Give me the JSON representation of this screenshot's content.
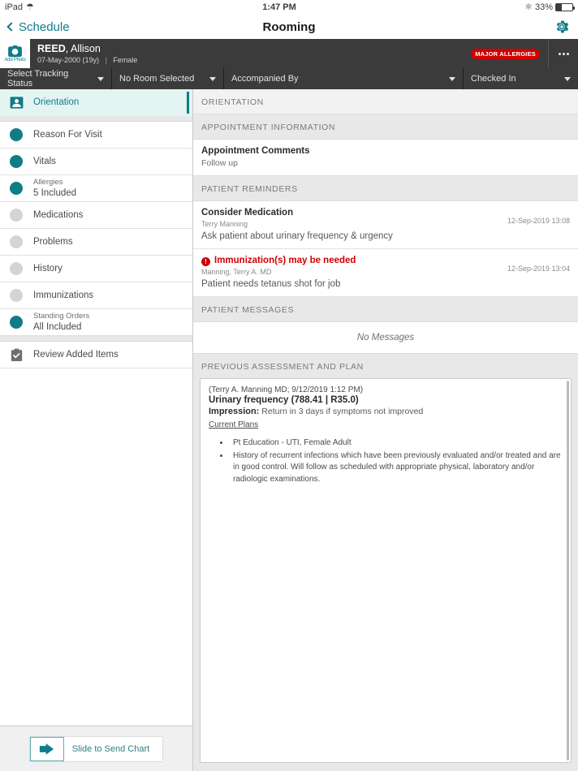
{
  "status_bar": {
    "device": "iPad",
    "wifi_icon": "wifi-icon",
    "time": "1:47 PM",
    "bluetooth_icon": "bluetooth-icon",
    "battery_percent": "33%",
    "battery_level": 33
  },
  "nav": {
    "back_label": "Schedule",
    "title": "Rooming",
    "settings_icon": "gear-icon",
    "accent_color": "#0F7C8A"
  },
  "patient": {
    "add_photo_label": "Add Photo",
    "camera_icon": "camera-icon",
    "last_name": "REED",
    "first_name": ", Allison",
    "dob": "07-May-2000 (19y)",
    "separator": "|",
    "sex": "Female",
    "allergy_badge": "MAJOR ALLERGIES",
    "allergy_color": "#d10000",
    "more_icon": "ellipsis-icon"
  },
  "dropdowns": [
    {
      "label": "Select Tracking Status",
      "name": "tracking-status-dropdown"
    },
    {
      "label": "No Room Selected",
      "name": "room-dropdown"
    },
    {
      "label": "Accompanied By",
      "name": "accompanied-by-dropdown"
    },
    {
      "label": "Checked In",
      "name": "checked-in-dropdown"
    }
  ],
  "sidebar": {
    "items": [
      {
        "label": "Orientation",
        "sub": "",
        "state": "active",
        "icon": "person-card-icon"
      },
      {
        "label": "Reason For Visit",
        "sub": "",
        "state": "filled",
        "icon": "status-dot-icon"
      },
      {
        "label": "Vitals",
        "sub": "",
        "state": "filled",
        "icon": "status-dot-icon"
      },
      {
        "label": "Allergies",
        "sub": "5 Included",
        "state": "filled",
        "icon": "status-dot-icon"
      },
      {
        "label": "Medications",
        "sub": "",
        "state": "empty",
        "icon": "status-dot-icon"
      },
      {
        "label": "Problems",
        "sub": "",
        "state": "empty",
        "icon": "status-dot-icon"
      },
      {
        "label": "History",
        "sub": "",
        "state": "empty",
        "icon": "status-dot-icon"
      },
      {
        "label": "Immunizations",
        "sub": "",
        "state": "empty",
        "icon": "status-dot-icon"
      },
      {
        "label": "Standing Orders",
        "sub": "All Included",
        "state": "filled",
        "icon": "status-dot-icon"
      }
    ],
    "review": {
      "label": "Review Added Items",
      "icon": "clipboard-check-icon"
    },
    "send": {
      "label": "Slide to Send Chart",
      "icon": "send-arrow-icon"
    }
  },
  "main": {
    "page_header": "ORIENTATION",
    "appointment_section": "APPOINTMENT INFORMATION",
    "appointment": {
      "title": "Appointment Comments",
      "body": "Follow up"
    },
    "reminders_section": "PATIENT REMINDERS",
    "reminders": [
      {
        "title": "Consider Medication",
        "author": "Terry Manning",
        "body": "Ask patient about urinary frequency & urgency",
        "time": "12-Sep-2019 13:08",
        "alert": false
      },
      {
        "title": "Immunization(s) may be needed",
        "author": "Manning, Terry A. MD",
        "body": "Patient needs tetanus shot for job",
        "time": "12-Sep-2019 13:04",
        "alert": true,
        "alert_glyph": "!"
      }
    ],
    "messages_section": "PATIENT MESSAGES",
    "no_messages": "No Messages",
    "assessment_section": "PREVIOUS ASSESSMENT AND PLAN",
    "assessment": {
      "meta": "(Terry A. Manning MD; 9/12/2019 1:12 PM)",
      "diagnosis": "Urinary frequency (788.41 | R35.0)",
      "impression_label": "Impression:",
      "impression_text": " Return in 3 days if symptoms not improved",
      "plans_link": "Current Plans",
      "plans": [
        "Pt Education - UTI, Female Adult",
        "History of recurrent infections which have been previously evaluated and/or treated and are in good control. Will follow as scheduled with appropriate physical, laboratory and/or radiologic examinations."
      ]
    }
  }
}
